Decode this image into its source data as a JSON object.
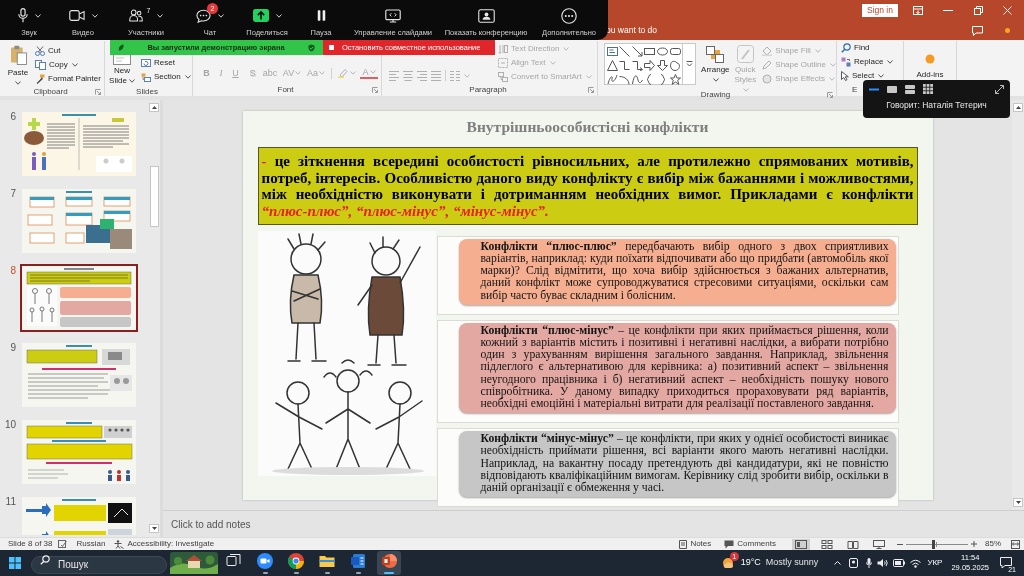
{
  "zoom_toolbar": {
    "items": [
      {
        "kind": "mic",
        "label": "Звук",
        "has_menu": true
      },
      {
        "kind": "video",
        "label": "Видео",
        "has_menu": true
      },
      {
        "kind": "participants",
        "label": "Участники",
        "count": "7",
        "has_menu": true
      },
      {
        "kind": "chat",
        "label": "Чат",
        "badge": "2",
        "has_menu": true
      },
      {
        "kind": "share",
        "label": "Поделиться",
        "has_menu": true
      },
      {
        "kind": "pause",
        "label": "Пауза",
        "has_menu": false
      },
      {
        "kind": "slides",
        "label": "Управление слайдами",
        "has_menu": false
      },
      {
        "kind": "conference",
        "label": "Показать конференцию",
        "has_menu": false
      },
      {
        "kind": "more",
        "label": "Дополнительно",
        "has_menu": false
      }
    ]
  },
  "share_banner": {
    "message": "Вы запустили демонстрацию экрана",
    "stop_button": "Остановить совместное использование"
  },
  "title_bar": {
    "tell_me": "ou want to do",
    "sign_in": "Sign in"
  },
  "ribbon": {
    "groups": [
      {
        "kind": "clipboard",
        "label": "Clipboard",
        "launcher": true,
        "items": [
          {
            "label": "Paste",
            "has_menu": true,
            "disabled": false
          },
          {
            "label": "Cut",
            "has_menu": false,
            "disabled": false
          },
          {
            "label": "Copy",
            "has_menu": true,
            "disabled": false
          },
          {
            "label": "Format Painter",
            "has_menu": false,
            "disabled": false
          }
        ]
      },
      {
        "kind": "slides",
        "label": "Slides",
        "launcher": false,
        "items": [
          {
            "label": "New Slide",
            "has_menu": true,
            "disabled": false
          },
          {
            "label": "Reset",
            "has_menu": false,
            "disabled": false
          },
          {
            "label": "Section",
            "has_menu": true,
            "disabled": false
          }
        ]
      },
      {
        "kind": "font",
        "label": "Font",
        "launcher": true,
        "items": [
          {
            "label": "B",
            "has_menu": false,
            "disabled": true
          },
          {
            "label": "I",
            "has_menu": false,
            "disabled": true
          },
          {
            "label": "U",
            "has_menu": false,
            "disabled": true
          },
          {
            "label": "S",
            "has_menu": false,
            "disabled": true
          },
          {
            "label": "abc",
            "has_menu": false,
            "disabled": true
          },
          {
            "label": "AV",
            "has_menu": true,
            "disabled": true
          },
          {
            "label": "Aa",
            "has_menu": true,
            "disabled": true
          },
          {
            "label": "A",
            "has_menu": true,
            "disabled": true
          }
        ]
      },
      {
        "kind": "paragraph",
        "label": "Paragraph",
        "launcher": true,
        "items": [
          {
            "label": "Text Direction",
            "has_menu": true,
            "disabled": true
          },
          {
            "label": "Align Text",
            "has_menu": true,
            "disabled": true
          },
          {
            "label": "Convert to SmartArt",
            "has_menu": true,
            "disabled": true
          }
        ]
      },
      {
        "kind": "drawing",
        "label": "Drawing",
        "launcher": true,
        "items": [
          {
            "label": "Arrange",
            "has_menu": true,
            "disabled": false
          },
          {
            "label": "Quick Styles",
            "has_menu": true,
            "disabled": true
          },
          {
            "label": "Shape Fill",
            "has_menu": true,
            "disabled": true
          },
          {
            "label": "Shape Outline",
            "has_menu": true,
            "disabled": true
          },
          {
            "label": "Shape Effects",
            "has_menu": true,
            "disabled": true
          }
        ]
      },
      {
        "kind": "editing",
        "label": "E",
        "launcher": false,
        "items": [
          {
            "label": "Find",
            "has_menu": false,
            "disabled": false
          },
          {
            "label": "Replace",
            "has_menu": true,
            "disabled": false
          },
          {
            "label": "Select",
            "has_menu": true,
            "disabled": false
          }
        ]
      },
      {
        "kind": "addins",
        "launcher": false,
        "items": [
          {
            "label": "Add-ins",
            "has_menu": false,
            "disabled": false
          }
        ]
      }
    ]
  },
  "speaker_overlay": {
    "views": [
      {
        "kind": "minimized",
        "selected": true
      },
      {
        "kind": "speaker",
        "selected": false
      },
      {
        "kind": "strip",
        "selected": false
      },
      {
        "kind": "gallery",
        "selected": false
      }
    ],
    "speaker": "Говорит: Наталія Тетерич"
  },
  "slides_panel": {
    "thumbnails": [
      {
        "number": "6",
        "kind": "two-column",
        "selected": false
      },
      {
        "number": "7",
        "kind": "diagram",
        "selected": false
      },
      {
        "number": "8",
        "kind": "boxes",
        "selected": true
      },
      {
        "number": "9",
        "kind": "text-image",
        "selected": false
      },
      {
        "number": "10",
        "kind": "banded",
        "selected": false
      },
      {
        "number": "11",
        "kind": "arrows",
        "selected": false
      }
    ]
  },
  "slide": {
    "title": "Внутрішньоособистісні конфлікти",
    "definition": [
      {
        "text": "-",
        "accent": true
      },
      {
        "text": "це зіткнення всередині особистості рівносильних, але протилежно спрямованих мотивів, потреб, інтересів. Особливістю даного виду конфлікту є вибір між бажаннями і можливостями, між необхідністю виконувати і дотриманням необхідних вимог. Прикладами є конфлікти",
        "accent": false
      },
      {
        "text": "“плюс-плюс”, “плюс-мінус”, “мінус-мінус”.",
        "accent": true
      }
    ],
    "boxes": [
      {
        "text": "**Конфлікти “плюс-плюс”** передбачають вибір одного з двох сприятливих варіантів, наприклад: куди поїхати відпочивати або що придбати (автомобіль якої марки)? Слід відмітити, що хоча вибір здійснюється з бажаних альтернатив, даний конфлікт може супроводжуватися стресовими ситуаціями, оскільки сам вибір часто буває складним і болісним.",
        "color": "#f5ae90"
      },
      {
        "text": "**Конфлікти “плюс-мінус”** – це конфлікти при яких приймається рішення, коли кожний з варіантів містить і позитивні і негативні наслідки, а вибрати потрібно один з урахуванням вирішення загального завдання. Наприклад, звільнення підлеглого є альтернативою для керівника: а) позитивний аспект – звільнення неугодного працівника і б) негативний аспект – необхідність пошуку нового співробітника. У даному випадку приходиться прораховувати ряд варіантів, необхідні емоційні і матеріальні витрати для реалізації поставленого завдання.",
        "color": "#e2a8a1"
      },
      {
        "text": "**Конфлікти “мінус-мінус”** – це конфлікти, при яких у однієї особистості виникає необхідність приймати рішення, всі варіанти якого мають негативні наслідки. Наприклад, на вакантну посаду претендують дві кандидатури, які не повністю відповідають кваліфікаційним вимогам. Керівнику слід зробити вибір, оскільки в даній організації є обмеження у часі.",
        "color": "#c6c6c6"
      }
    ]
  },
  "notes": {
    "placeholder": "Click to add notes"
  },
  "status_bar": {
    "slide_info": "Slide 8 of 38",
    "language": "Russian",
    "accessibility": "Accessibility: Investigate",
    "notes_button": "Notes",
    "comments_button": "Comments",
    "views": [
      {
        "kind": "normal",
        "selected": true
      },
      {
        "kind": "sorter",
        "selected": false
      },
      {
        "kind": "reading",
        "selected": false
      },
      {
        "kind": "slideshow",
        "selected": false
      }
    ],
    "zoom": {
      "level": 0.43,
      "reading": "85%"
    }
  },
  "taskbar": {
    "search": {
      "placeholder": "Пошук"
    },
    "apps": [
      {
        "kind": "task-view",
        "running": false,
        "active": false
      },
      {
        "kind": "zoom",
        "running": true,
        "active": false
      },
      {
        "kind": "chrome",
        "running": true,
        "active": false
      },
      {
        "kind": "explorer",
        "running": true,
        "active": false
      },
      {
        "kind": "word",
        "running": true,
        "active": false
      },
      {
        "kind": "powerpoint",
        "running": true,
        "active": true
      }
    ],
    "weather": {
      "temperature": "19°C",
      "condition": "Mostly sunny",
      "badge": "1"
    },
    "language": "УКР",
    "clock": {
      "time": "11:54",
      "date": "29.05.2025"
    },
    "notifications": "21"
  }
}
